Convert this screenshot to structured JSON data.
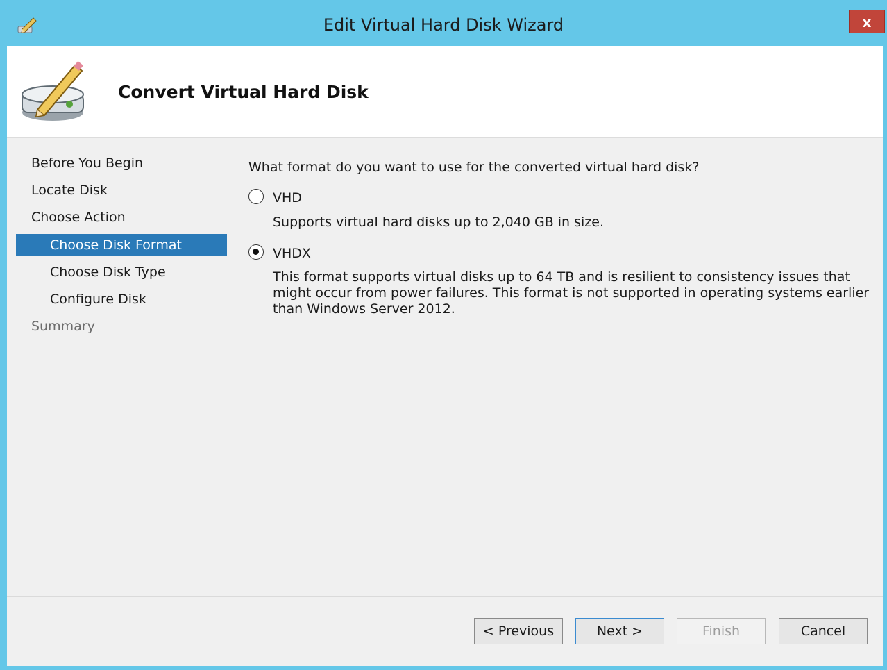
{
  "window": {
    "title": "Edit Virtual Hard Disk Wizard",
    "close_label": "x"
  },
  "header": {
    "title": "Convert Virtual Hard Disk"
  },
  "nav": {
    "items": [
      {
        "label": "Before You Begin",
        "state": "normal"
      },
      {
        "label": "Locate Disk",
        "state": "normal"
      },
      {
        "label": "Choose Action",
        "state": "normal"
      },
      {
        "label": "Choose Disk Format",
        "state": "active"
      },
      {
        "label": "Choose Disk Type",
        "state": "normal"
      },
      {
        "label": "Configure Disk",
        "state": "normal"
      },
      {
        "label": "Summary",
        "state": "disabled"
      }
    ]
  },
  "content": {
    "question": "What format do you want to use for the converted virtual hard disk?",
    "options": [
      {
        "label": "VHD",
        "checked": false,
        "description": "Supports virtual hard disks up to 2,040 GB in size."
      },
      {
        "label": "VHDX",
        "checked": true,
        "description": "This format supports virtual disks up to 64 TB and is resilient to consistency issues that might occur from power failures. This format is not supported in operating systems earlier than Windows Server 2012."
      }
    ]
  },
  "buttons": {
    "previous": "< Previous",
    "next": "Next >",
    "finish": "Finish",
    "cancel": "Cancel"
  },
  "colors": {
    "titlebar": "#64c7e8",
    "nav_active": "#2a7ab8",
    "close_button": "#c1453a"
  }
}
